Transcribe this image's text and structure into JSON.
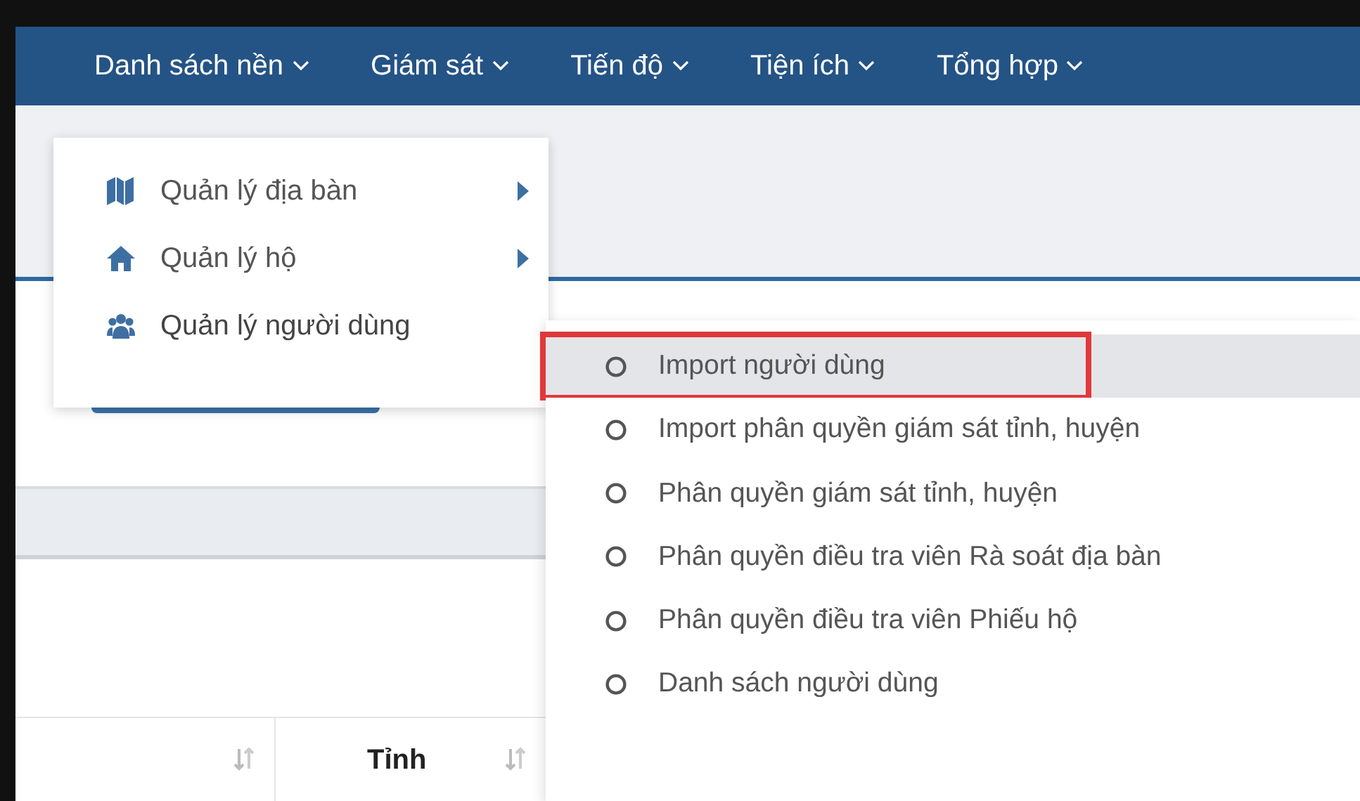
{
  "navbar": {
    "items": [
      {
        "label": "Danh sách nền"
      },
      {
        "label": "Giám sát"
      },
      {
        "label": "Tiến độ"
      },
      {
        "label": "Tiện ích"
      },
      {
        "label": "Tổng hợp"
      }
    ]
  },
  "dropdown": {
    "items": [
      {
        "label": "Quản lý địa bàn",
        "kind": "map",
        "has_submenu": true,
        "expanded": false
      },
      {
        "label": "Quản lý hộ",
        "kind": "home",
        "has_submenu": true,
        "expanded": false
      },
      {
        "label": "Quản lý người dùng",
        "kind": "users",
        "has_submenu": false,
        "expanded": true
      }
    ]
  },
  "submenu": {
    "items": [
      {
        "label": "Import người dùng",
        "selected": true,
        "annotated": true
      },
      {
        "label": "Import phân quyền giám sát tỉnh, huyện",
        "selected": false,
        "annotated": false
      },
      {
        "label": "Phân quyền giám sát tỉnh, huyện",
        "selected": false,
        "annotated": false
      },
      {
        "label": "Phân quyền điều tra viên Rà soát địa bàn",
        "selected": false,
        "annotated": false
      },
      {
        "label": "Phân quyền điều tra viên Phiếu hộ",
        "selected": false,
        "annotated": false
      },
      {
        "label": "Danh sách người dùng",
        "selected": false,
        "annotated": false
      }
    ]
  },
  "table": {
    "columns": [
      {
        "sortable": true
      },
      {
        "label": "Tỉnh",
        "sortable": true
      }
    ]
  }
}
